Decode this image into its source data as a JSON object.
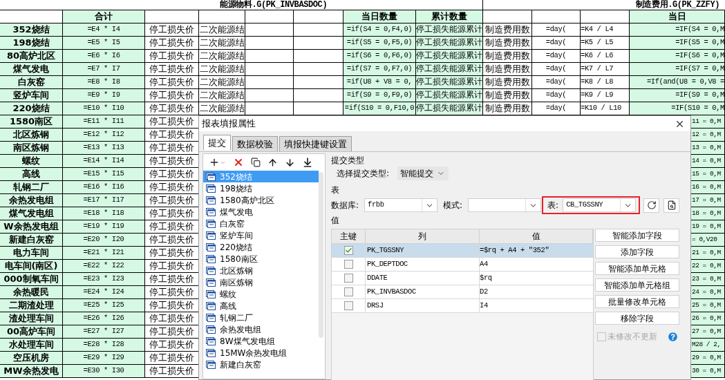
{
  "sheet": {
    "titles": [
      "能源物料.G(PK_INVBASDOC)",
      "制造费用.G(PK_ZZFY)"
    ],
    "headers": {
      "total": "合计",
      "daily_qty": "当日数量",
      "cumulative_qty": "累计数量",
      "daily": "当日"
    },
    "rows": [
      {
        "kind": "full",
        "name": "352烧结",
        "total": "=E4 * I4",
        "price": "停工损失价",
        "source": "二次能源结",
        "daily_formula": "=if(S4 = 0,F4,0)",
        "cumulative": "停工损失能源累计",
        "cost": "制造费用数",
        "day": "=day(",
        "ratio": "=K4 / L4",
        "formula": "=IF(S4 = 0,M"
      },
      {
        "kind": "full",
        "name": "198烧结",
        "total": "=E5 * I5",
        "price": "停工损失价",
        "source": "二次能源结",
        "daily_formula": "=if(S5 = 0,F5,0)",
        "cumulative": "停工损失能源累计",
        "cost": "制造费用数",
        "day": "=day(",
        "ratio": "=K5 / L5",
        "formula": "=IF(S5 = 0,M"
      },
      {
        "kind": "full",
        "name": "80高炉北区",
        "total": "=E6 * I6",
        "price": "停工损失价",
        "source": "二次能源结",
        "daily_formula": "=if(S6 = 0,F6,0)",
        "cumulative": "停工损失能源累计",
        "cost": "制造费用数",
        "day": "=day(",
        "ratio": "=K6 / L6",
        "formula": "=IF(S6 = 0,M"
      },
      {
        "kind": "full",
        "name": "煤气发电",
        "total": "=E7 * I7",
        "price": "停工损失价",
        "source": "二次能源结",
        "daily_formula": "=if(S7 = 0,F7,0)",
        "cumulative": "停工损失能源累计",
        "cost": "制造费用数",
        "day": "=day(",
        "ratio": "=K7 / L7",
        "formula": "=IF(S7 = 0,M"
      },
      {
        "kind": "full",
        "name": "白灰窑",
        "total": "=E8 * I8",
        "price": "停工损失价",
        "source": "二次能源结",
        "daily_formula": "=if(U8 + V8 = 0,",
        "cumulative": "停工损失能源累计",
        "cost": "制造费用数",
        "day": "=day(",
        "ratio": "=K8 / L8",
        "formula": "=If(and(U8 = 0,V8 ="
      },
      {
        "kind": "full",
        "name": "竖炉车间",
        "total": "=E9 * I9",
        "price": "停工损失价",
        "source": "二次能源结",
        "daily_formula": "=if(S9 = 0,F9,0)",
        "cumulative": "停工损失能源累计",
        "cost": "制造费用数",
        "day": "=day(",
        "ratio": "=K9 / L9",
        "formula": "=IF(S9 = 0,M"
      },
      {
        "kind": "full",
        "name": "220烧结",
        "total": "=E10 * I10",
        "price": "停工损失价",
        "source": "二次能源结",
        "daily_formula": "=if(S10 = 0,F10,0",
        "cumulative": "停工损失能源累计",
        "cost": "制造费用数",
        "day": "=day(",
        "ratio": "=K10 / L10",
        "formula": "=IF(S10 = 0,M"
      },
      {
        "kind": "covered",
        "name": "1580南区",
        "total": "=E11 * I11",
        "price": "停工损失价",
        "tail": "11 = 0,M"
      },
      {
        "kind": "covered",
        "name": "北区炼钢",
        "total": "=E12 * I12",
        "price": "停工损失价",
        "tail": "12 = 0,M"
      },
      {
        "kind": "covered",
        "name": "南区炼钢",
        "total": "=E13 * I13",
        "price": "停工损失价",
        "tail": "13 = 0,M"
      },
      {
        "kind": "covered",
        "name": "螺纹",
        "total": "=E14 * I14",
        "price": "停工损失价",
        "tail": "14 = 0,M"
      },
      {
        "kind": "covered",
        "name": "高线",
        "total": "=E15 * I15",
        "price": "停工损失价",
        "tail": "15 = 0,M"
      },
      {
        "kind": "covered",
        "name": "轧钢二厂",
        "total": "=E16 * I16",
        "price": "停工损失价",
        "tail": "16 = 0,M"
      },
      {
        "kind": "covered",
        "name": "余热发电组",
        "total": "=E17 * I17",
        "price": "停工损失价",
        "tail": "17 = 0,M"
      },
      {
        "kind": "covered",
        "name": "煤气发电组",
        "total": "=E18 * I18",
        "price": "停工损失价",
        "tail": "18 = 0,M"
      },
      {
        "kind": "covered",
        "name": "W余热发电组",
        "total": "=E19 * I19",
        "price": "停工损失价",
        "tail": "19 = 0,M"
      },
      {
        "kind": "covered",
        "name": "新建白灰窑",
        "total": "=E20 * I20",
        "price": "停工损失价",
        "tail": "= 0,V20"
      },
      {
        "kind": "covered",
        "name": "电力车间",
        "total": "=E21 * I21",
        "price": "停工损失价",
        "tail": "21 = 0,M"
      },
      {
        "kind": "covered",
        "name": "电车间(南区)",
        "total": "=E22 * I22",
        "price": "停工损失价",
        "tail": "22 = 0,M"
      },
      {
        "kind": "covered",
        "name": "000制氧车间",
        "total": "=E23 * I23",
        "price": "停工损失价",
        "tail": "23 = 0,M"
      },
      {
        "kind": "covered",
        "name": "余热暖民",
        "total": "=E24 * I24",
        "price": "停工损失价",
        "tail": "24 = 0,M"
      },
      {
        "kind": "covered",
        "name": "二期渣处理",
        "total": "=E25 * I25",
        "price": "停工损失价",
        "tail": "25 = 0,M"
      },
      {
        "kind": "covered",
        "name": "渣处理车间",
        "total": "=E26 * I26",
        "price": "停工损失价",
        "tail": "26 = 0,M"
      },
      {
        "kind": "covered",
        "name": "00高炉车间",
        "total": "=E27 * I27",
        "price": "停工损失价",
        "tail": "27 = 0,M"
      },
      {
        "kind": "covered",
        "name": "水处理车间",
        "total": "=E28 * I28",
        "price": "停工损失价",
        "tail": "M28 / 2,"
      },
      {
        "kind": "covered",
        "name": "空压机房",
        "total": "=E29 * I29",
        "price": "停工损失价",
        "tail": "29 = 0,M"
      },
      {
        "kind": "covered",
        "name": "MW余热发电",
        "total": "=E30 * I30",
        "price": "停工损失价",
        "tail": "30 = 0,M"
      }
    ]
  },
  "dialog": {
    "title": "报表填报属性",
    "tabs": [
      {
        "label": "提交",
        "selected": true
      },
      {
        "label": "数据校验",
        "selected": false
      },
      {
        "label": "填报快捷键设置",
        "selected": false
      }
    ],
    "items": [
      {
        "label": "352烧结",
        "selected": true
      },
      {
        "label": "198烧结",
        "selected": false
      },
      {
        "label": "1580高炉北区",
        "selected": false
      },
      {
        "label": "煤气发电",
        "selected": false
      },
      {
        "label": "白灰窑",
        "selected": false
      },
      {
        "label": "竖炉车间",
        "selected": false
      },
      {
        "label": "220烧结",
        "selected": false
      },
      {
        "label": "1580南区",
        "selected": false
      },
      {
        "label": "北区炼钢",
        "selected": false
      },
      {
        "label": "南区炼钢",
        "selected": false
      },
      {
        "label": "螺纹",
        "selected": false
      },
      {
        "label": "高线",
        "selected": false
      },
      {
        "label": "轧钢二厂",
        "selected": false
      },
      {
        "label": "余热发电组",
        "selected": false
      },
      {
        "label": "8W煤气发电组",
        "selected": false
      },
      {
        "label": "15MW余热发电组",
        "selected": false
      },
      {
        "label": "新建白灰窑",
        "selected": false
      }
    ],
    "submit": {
      "group_label": "提交类型",
      "type_label": "选择提交类型:",
      "type_value": "智能提交"
    },
    "table": {
      "group_label": "表",
      "database_label": "数据库:",
      "database_value": "frbb",
      "schema_label": "模式:",
      "table_label": "表:",
      "table_value": "CB_TGSSNY",
      "highlighted": true
    },
    "values": {
      "group_label": "值",
      "columns": [
        "主键",
        "列",
        "值"
      ],
      "rows": [
        {
          "key": true,
          "column": "PK_TGSSNY",
          "value": "=$rq + A4 + \"352\"",
          "selected": true
        },
        {
          "key": false,
          "column": "PK_DEPTDOC",
          "value": "A4",
          "selected": false
        },
        {
          "key": false,
          "column": "DDATE",
          "value": "$rq",
          "selected": false
        },
        {
          "key": false,
          "column": "PK_INVBASDOC",
          "value": "D2",
          "selected": false
        },
        {
          "key": false,
          "column": "DRSJ",
          "value": "I4",
          "selected": false
        }
      ],
      "buttons": [
        "智能添加字段",
        "添加字段",
        "智能添加单元格",
        "智能添加单元格组",
        "批量修改单元格",
        "移除字段"
      ],
      "no_update": {
        "label": "未修改不更新",
        "checked": false,
        "disabled": true
      }
    }
  }
}
